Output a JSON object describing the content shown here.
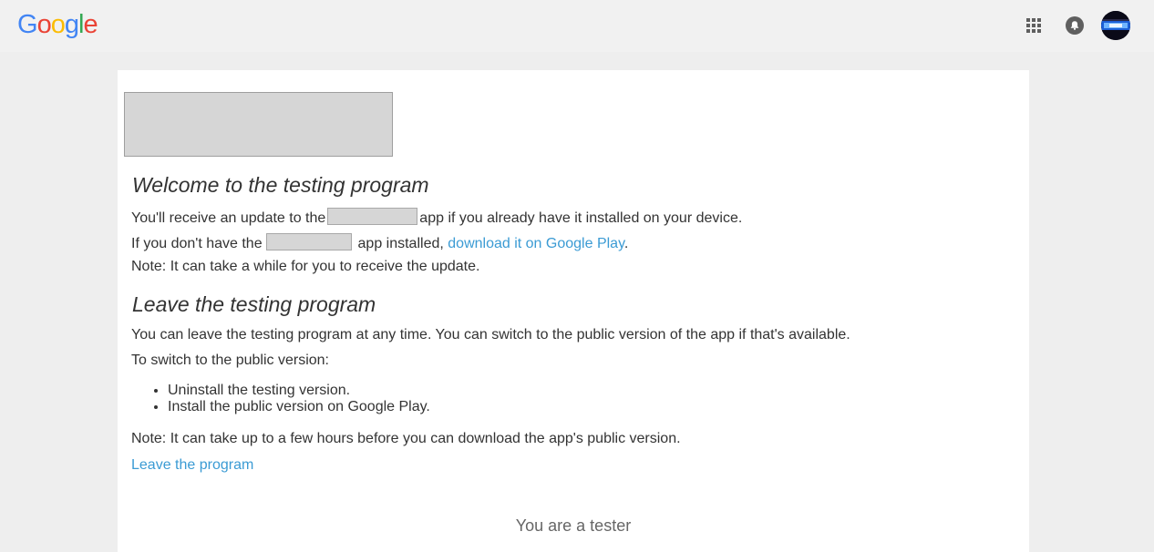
{
  "header": {
    "logo_letters": [
      {
        "ch": "G",
        "color": "#4285F4"
      },
      {
        "ch": "o",
        "color": "#EA4335"
      },
      {
        "ch": "o",
        "color": "#FBBC05"
      },
      {
        "ch": "g",
        "color": "#4285F4"
      },
      {
        "ch": "l",
        "color": "#34A853"
      },
      {
        "ch": "e",
        "color": "#EA4335"
      }
    ],
    "icons": {
      "apps": "apps-grid-icon",
      "notifications": "notifications-bell-icon",
      "account": "account-avatar"
    }
  },
  "welcome": {
    "heading": "Welcome to the testing program",
    "line1_before": "You'll receive an update to the",
    "line1_after": "app if you already have it installed on your device.",
    "line2_before": "If you don't have the",
    "line2_middle": "app installed,",
    "line2_link": "download it on Google Play",
    "line2_end": ".",
    "note": "Note: It can take a while for you to receive the update."
  },
  "leave": {
    "heading": "Leave the testing program",
    "intro": "You can leave the testing program at any time. You can switch to the public version of the app if that's available.",
    "switch_label": "To switch to the public version:",
    "steps": [
      "Uninstall the testing version.",
      "Install the public version on Google Play."
    ],
    "note": "Note: It can take up to a few hours before you can download the app's public version.",
    "leave_link": "Leave the program"
  },
  "status": {
    "text": "You are a tester"
  },
  "colors": {
    "link": "#3b9bd4",
    "text": "#333333",
    "page_bg": "#eeeeee",
    "card_bg": "#ffffff"
  }
}
